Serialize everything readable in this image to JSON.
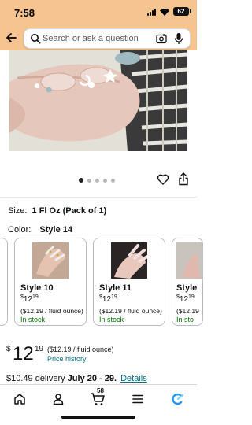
{
  "status_bar": {
    "time": "7:58",
    "battery": "62"
  },
  "search": {
    "placeholder": "Search or ask a question"
  },
  "carousel": {
    "dot_count": 5,
    "active_index": 0
  },
  "size": {
    "label": "Size:",
    "value": "1 Fl Oz (Pack of 1)"
  },
  "color": {
    "label": "Color:",
    "value": "Style 14"
  },
  "swatches": [
    {
      "name": "Style 10",
      "price_dollar": "$",
      "price_whole": "12",
      "price_cents": "19",
      "unit_price": "($12.19 / fluid ounce)",
      "stock": "In stock"
    },
    {
      "name": "Style 11",
      "price_dollar": "$",
      "price_whole": "12",
      "price_cents": "19",
      "unit_price": "($12.19 / fluid ounce)",
      "stock": "In stock"
    },
    {
      "name": "Style",
      "price_dollar": "$",
      "price_whole": "12",
      "price_cents": "19",
      "unit_price": "($12.19",
      "stock": "In sto"
    }
  ],
  "price": {
    "dollar": "$",
    "whole": "12",
    "cents": "19",
    "unit": "($12.19 / fluid ounce)",
    "history_link": "Price history"
  },
  "delivery": {
    "prefix": "$10.49 delivery",
    "dates": "July 20 - 29.",
    "details_link": "Details"
  },
  "nav": {
    "cart_count": "58"
  },
  "colors": {
    "header_bg": "#f5c490",
    "link": "#007185",
    "in_stock": "#007600",
    "assistant_icon": "#1a98ff"
  }
}
